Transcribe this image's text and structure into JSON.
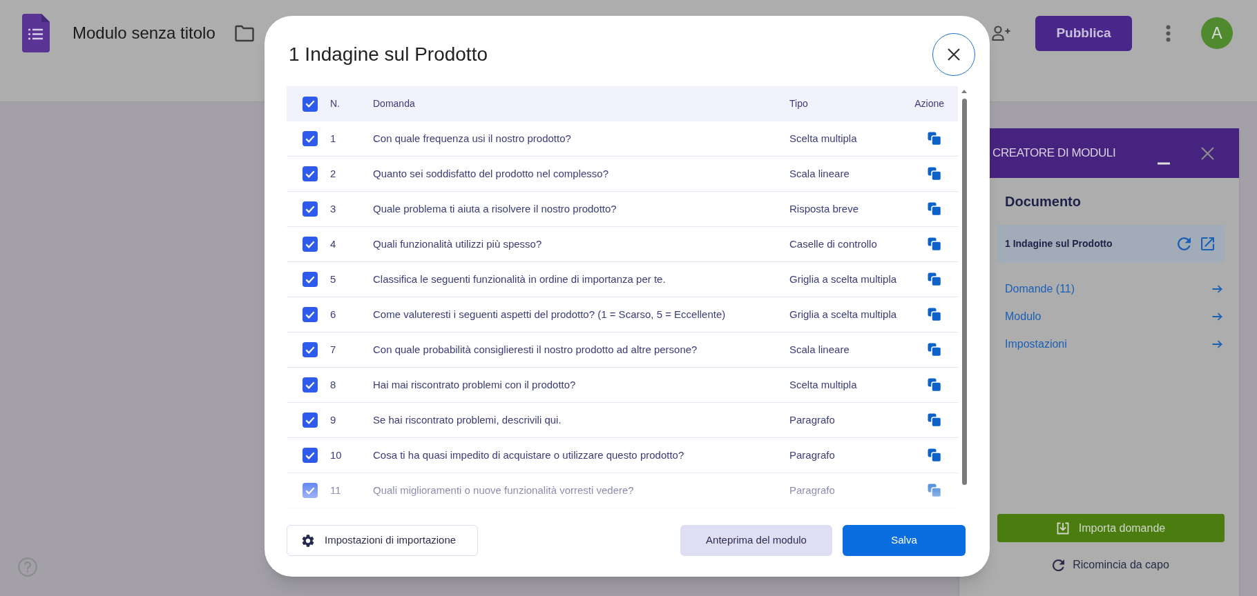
{
  "app_bar": {
    "title": "Modulo senza titolo",
    "publish_button": "Pubblica",
    "avatar_initial": "A"
  },
  "dialog": {
    "title": "1 Indagine sul Prodotto",
    "table": {
      "all_checked": true,
      "columns": [
        "N.",
        "Domanda",
        "Tipo",
        "Azione"
      ],
      "rows": [
        {
          "number": "1",
          "question": "Con quale frequenza usi il nostro prodotto?",
          "type": "Scelta multipla",
          "checked": true
        },
        {
          "number": "2",
          "question": "Quanto sei soddisfatto del prodotto nel complesso?",
          "type": "Scala lineare",
          "checked": true
        },
        {
          "number": "3",
          "question": "Quale problema ti aiuta a risolvere il nostro prodotto?",
          "type": "Risposta breve",
          "checked": true
        },
        {
          "number": "4",
          "question": "Quali funzionalità utilizzi più spesso?",
          "type": "Caselle di controllo",
          "checked": true
        },
        {
          "number": "5",
          "question": "Classifica le seguenti funzionalità in ordine di importanza per te.",
          "type": "Griglia a scelta multipla",
          "checked": true
        },
        {
          "number": "6",
          "question": "Come valuteresti i seguenti aspetti del prodotto? (1 = Scarso, 5 = Eccellente)",
          "type": "Griglia a scelta multipla",
          "checked": true
        },
        {
          "number": "7",
          "question": "Con quale probabilità consiglieresti il nostro prodotto ad altre persone?",
          "type": "Scala lineare",
          "checked": true
        },
        {
          "number": "8",
          "question": "Hai mai riscontrato problemi con il prodotto?",
          "type": "Scelta multipla",
          "checked": true
        },
        {
          "number": "9",
          "question": "Se hai riscontrato problemi, descrivili qui.",
          "type": "Paragrafo",
          "checked": true
        },
        {
          "number": "10",
          "question": "Cosa ti ha quasi impedito di acquistare o utilizzare questo prodotto?",
          "type": "Paragrafo",
          "checked": true
        },
        {
          "number": "11",
          "question": "Quali miglioramenti o nuove funzionalità vorresti vedere?",
          "type": "Paragrafo",
          "checked": true
        }
      ]
    },
    "buttons": [
      {
        "label": "Impostazioni di importazione",
        "kind": "settings"
      },
      {
        "label": "Anteprima del modulo",
        "kind": "secondary"
      },
      {
        "label": "Salva",
        "kind": "primary"
      }
    ]
  },
  "side_panel": {
    "title": "CREATORE DI MODULI",
    "section_title": "Documento",
    "document": {
      "title": "1 Indagine sul Prodotto"
    },
    "links": [
      {
        "label": "Domande (11)"
      },
      {
        "label": "Modulo"
      },
      {
        "label": "Impostazioni"
      }
    ],
    "import_button": "Importa domande",
    "restart_button": "Ricomincia da capo"
  }
}
